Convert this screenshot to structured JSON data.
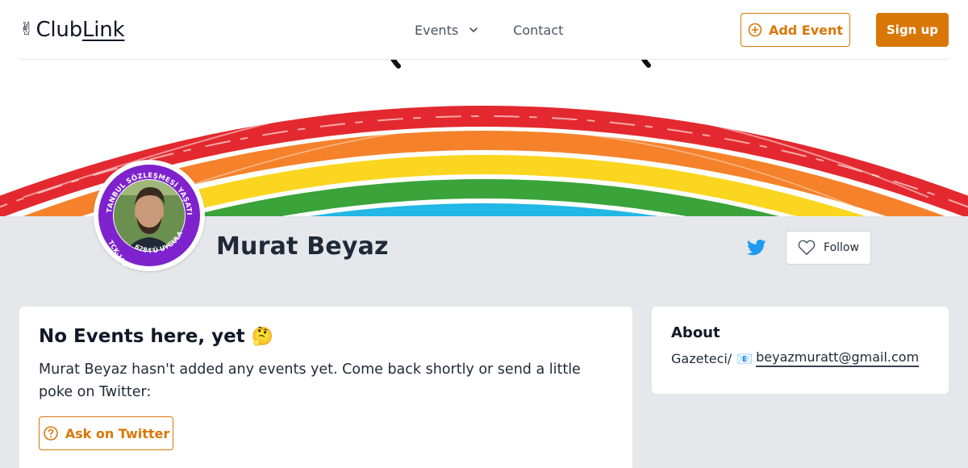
{
  "header": {
    "logo_icon": "victory-hand-icon",
    "logo_club": "Club",
    "logo_link": "Link",
    "nav": {
      "events_label": "Events",
      "contact_label": "Contact"
    },
    "add_event_label": "Add Event",
    "sign_up_label": "Sign up"
  },
  "profile": {
    "name": "Murat Beyaz",
    "avatar_ring_text_top": "İSTANBUL SÖZLEŞMESİ YAŞATIR",
    "avatar_ring_text_left": "TCK-103",
    "avatar_ring_text_bottom": "6284'Ü UYGULA",
    "twitter_icon": "twitter-bird-icon",
    "follow_label": "Follow"
  },
  "events_card": {
    "title": "No Events here, yet",
    "title_emoji": "🤔",
    "text": "Murat Beyaz hasn't added any events yet. Come back shortly or send a little poke on Twitter:",
    "ask_label": "Ask on Twitter"
  },
  "about_card": {
    "title": "About",
    "text_prefix": "Gazeteci/",
    "text_emoji": "📧",
    "email": "beyazmuratt@gmail.com"
  },
  "colors": {
    "accent": "#d97706",
    "page_bg": "#e5e7eb",
    "avatar_ring": "#7e22ce"
  }
}
